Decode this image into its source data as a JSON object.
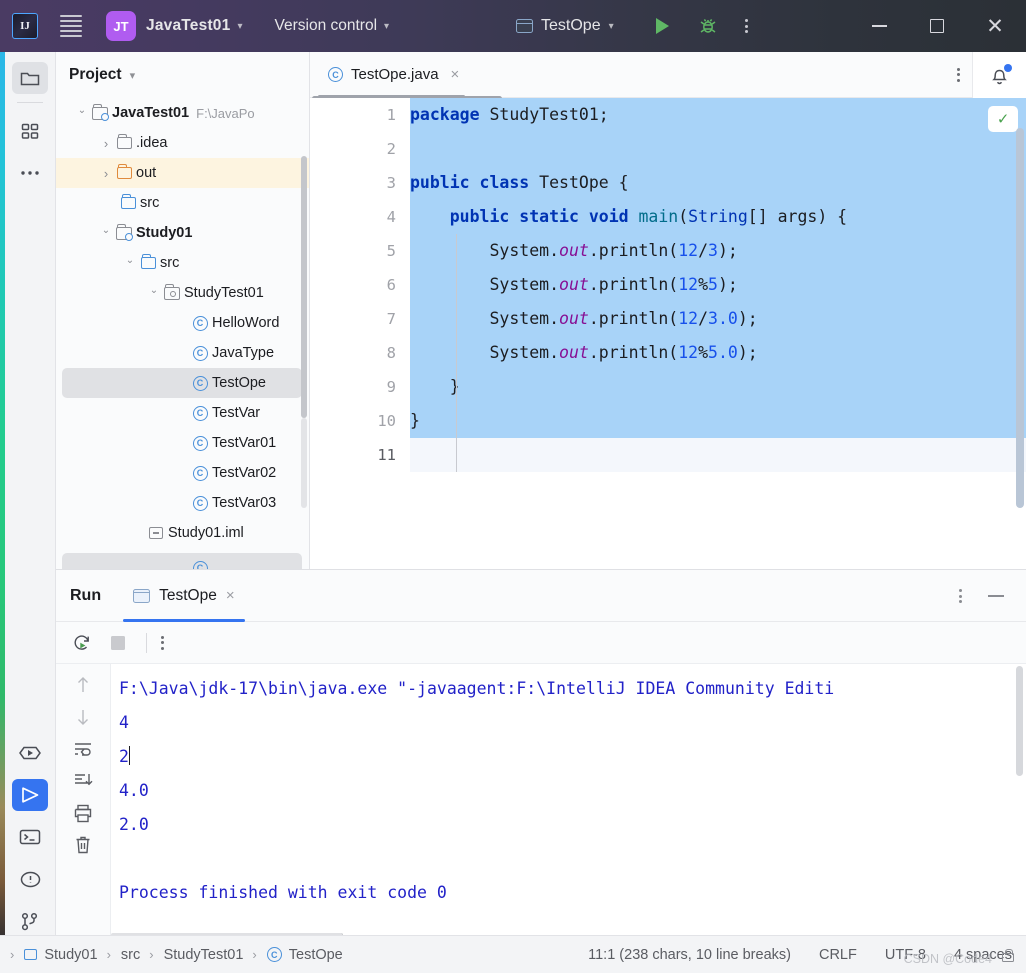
{
  "titlebar": {
    "logo_alt": "intellij-idea-logo",
    "project_badge": "JT",
    "project_name": "JavaTest01",
    "vcs_label": "Version control",
    "run_config": "TestOpe",
    "run_button": "run-button",
    "debug_button": "debug-button",
    "more_button": "more-actions"
  },
  "project_panel": {
    "title": "Project",
    "tree": [
      {
        "label": "JavaTest01",
        "path": "F:\\JavaPo",
        "icon": "module-icon",
        "depth": 0,
        "arrow": "open",
        "bold": true
      },
      {
        "label": ".idea",
        "icon": "folder-icon",
        "depth": 1,
        "arrow": "closed",
        "bold": false
      },
      {
        "label": "out",
        "icon": "folder-icon-orange",
        "depth": 1,
        "arrow": "closed",
        "bold": false,
        "highlight": "warn"
      },
      {
        "label": "src",
        "icon": "folder-icon-blue",
        "depth": 2,
        "arrow": "none",
        "bold": false
      },
      {
        "label": "Study01",
        "icon": "module-icon",
        "depth": 1,
        "arrow": "open",
        "bold": true
      },
      {
        "label": "src",
        "icon": "folder-icon-blue",
        "depth": 2,
        "arrow": "open",
        "bold": false
      },
      {
        "label": "StudyTest01",
        "icon": "package-icon",
        "depth": 3,
        "arrow": "open",
        "bold": false
      },
      {
        "label": "HelloWord",
        "icon": "class-icon",
        "depth": 4,
        "arrow": "none",
        "bold": false
      },
      {
        "label": "JavaType",
        "icon": "class-icon",
        "depth": 4,
        "arrow": "none",
        "bold": false
      },
      {
        "label": "TestOpe",
        "icon": "class-icon",
        "depth": 4,
        "arrow": "none",
        "bold": false,
        "highlight": "selected"
      },
      {
        "label": "TestVar",
        "icon": "class-icon",
        "depth": 4,
        "arrow": "none",
        "bold": false
      },
      {
        "label": "TestVar01",
        "icon": "class-icon",
        "depth": 4,
        "arrow": "none",
        "bold": false
      },
      {
        "label": "TestVar02",
        "icon": "class-icon",
        "depth": 4,
        "arrow": "none",
        "bold": false
      },
      {
        "label": "TestVar03",
        "icon": "class-icon",
        "depth": 4,
        "arrow": "none",
        "bold": false
      },
      {
        "label": "Study01.iml",
        "icon": "iml-icon",
        "depth": 3,
        "arrow": "none",
        "bold": false
      }
    ]
  },
  "editor": {
    "tab_label": "TestOpe.java",
    "tab_icon": "class-icon",
    "close_label": "×",
    "inspection_badge": "✓",
    "line_numbers": [
      "1",
      "2",
      "3",
      "4",
      "5",
      "6",
      "7",
      "8",
      "9",
      "10",
      "11"
    ],
    "gutter_run_lines": [
      3,
      4
    ],
    "code": [
      "package StudyTest01;",
      "",
      "public class TestOpe {",
      "    public static void main(String[] args) {",
      "        System.out.println(12/3);",
      "        System.out.println(12%5);",
      "        System.out.println(12/3.0);",
      "        System.out.println(12%5.0);",
      "    }",
      "}",
      ""
    ]
  },
  "run_panel": {
    "title": "Run",
    "tab_label": "TestOpe",
    "tab_close": "×",
    "toolbar": {
      "rerun": "rerun-icon",
      "stop": "stop-icon",
      "more": "more-icon"
    },
    "gutter_icons": [
      "up-arrow-icon",
      "down-arrow-icon",
      "soft-wrap-icon",
      "scroll-to-end-icon",
      "print-icon",
      "trash-icon"
    ],
    "console_lines": [
      "F:\\Java\\jdk-17\\bin\\java.exe \"-javaagent:F:\\IntelliJ IDEA Community Editi",
      "4",
      "2",
      "4.0",
      "2.0",
      "",
      "Process finished with exit code 0"
    ],
    "caret_line_index": 2
  },
  "statusbar": {
    "breadcrumb": [
      "Study01",
      "src",
      "StudyTest01",
      "TestOpe"
    ],
    "position": "11:1 (238 chars, 10 line breaks)",
    "line_sep": "CRLF",
    "encoding": "UTF-8",
    "indent": "4 spaces",
    "watermark": "CSDN @Code4",
    "lock_icon": "lock-icon"
  },
  "rail": {
    "top_icons": [
      "project-folder-icon",
      "structure-icon",
      "more-tool-windows-icon"
    ],
    "bottom_icons": [
      "run-anything-icon",
      "run-icon",
      "terminal-icon",
      "problems-icon",
      "git-icon"
    ]
  },
  "colors": {
    "accent_blue": "#3574f0",
    "selection_blue": "#a8d3f8",
    "keyword": "#0033b3",
    "number": "#1750eb",
    "static_field": "#871094",
    "console_text": "#2222c8",
    "run_green": "#5fb865"
  }
}
